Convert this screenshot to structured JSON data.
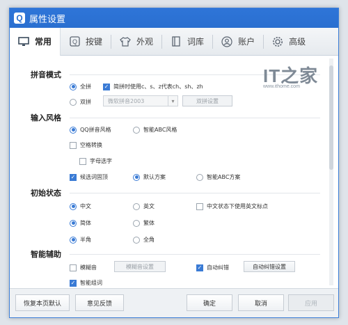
{
  "window": {
    "title": "属性设置",
    "logo_letter": "Q"
  },
  "tabs": [
    {
      "label": "常用",
      "icon": "monitor-icon",
      "active": true
    },
    {
      "label": "按键",
      "icon": "key-icon"
    },
    {
      "label": "外观",
      "icon": "shirt-icon"
    },
    {
      "label": "词库",
      "icon": "book-icon"
    },
    {
      "label": "账户",
      "icon": "user-icon"
    },
    {
      "label": "高级",
      "icon": "gear-icon"
    }
  ],
  "watermark": {
    "logo": "IT之家",
    "url": "www.ithome.com"
  },
  "pinyin_mode": {
    "title": "拼音模式",
    "full_pinyin": {
      "label": "全拼",
      "selected": true
    },
    "fuzzy_option": {
      "label": "简拼时使用c、s、z代表ch、sh、zh",
      "checked": true
    },
    "double_pinyin": {
      "label": "双拼",
      "selected": false
    },
    "double_scheme_select": {
      "value": "微软拼音2003"
    },
    "double_settings_button": "双拼设置"
  },
  "input_style": {
    "title": "输入风格",
    "qq_style": {
      "label": "QQ拼音风格",
      "selected": true
    },
    "abc_style": {
      "label": "智能ABC风格",
      "selected": false
    },
    "space_convert": {
      "label": "空格转换",
      "checked": false
    },
    "letter_select": {
      "label": "字母选字",
      "checked": false
    },
    "candidate_fixed": {
      "label": "候选词固顶",
      "checked": true
    },
    "default_scheme": {
      "label": "默认方案",
      "selected": true
    },
    "abc_scheme": {
      "label": "智能ABC方案",
      "selected": false
    }
  },
  "initial_state": {
    "title": "初始状态",
    "chinese": {
      "label": "中文",
      "selected": true
    },
    "english": {
      "label": "英文",
      "selected": false
    },
    "english_punct": {
      "label": "中文状态下使用英文标点",
      "checked": false
    },
    "simplified": {
      "label": "简体",
      "selected": true
    },
    "traditional": {
      "label": "繁体",
      "selected": false
    },
    "half_width": {
      "label": "半角",
      "selected": true
    },
    "full_width": {
      "label": "全角",
      "selected": false
    }
  },
  "smart_assist": {
    "title": "智能辅助",
    "fuzzy_sound": {
      "label": "模糊音",
      "checked": false
    },
    "fuzzy_settings_button": "模糊音设置",
    "auto_correct": {
      "label": "自动纠错",
      "checked": true
    },
    "auto_correct_settings_button": "自动纠错设置",
    "smart_phrase": {
      "label": "智能组词",
      "checked": true
    }
  },
  "footer": {
    "restore_default": "恢复本页默认",
    "feedback": "意见反馈",
    "ok": "确定",
    "cancel": "取消",
    "apply": "应用"
  },
  "colors": {
    "accent": "#3a7bd5",
    "titlebar": "#2a6fd0"
  }
}
